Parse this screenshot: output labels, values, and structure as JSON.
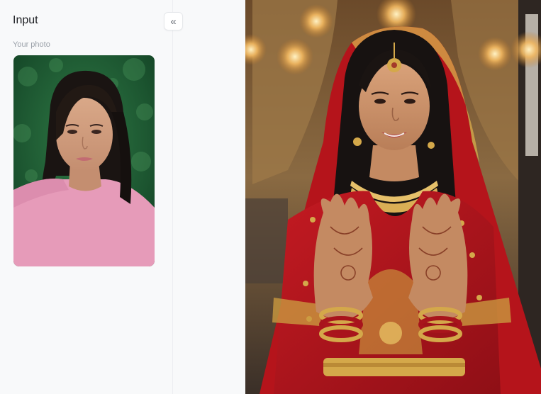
{
  "panel": {
    "title": "Input",
    "photo_label": "Your photo",
    "collapse_glyph": "«"
  },
  "icons": {
    "collapse": "double-chevron-left-icon"
  },
  "colors": {
    "panel_bg": "#f8f9fa",
    "dress_red": "#b5141b",
    "gold": "#d4a84a",
    "shirt_pink": "#e89ab8",
    "foliage_green": "#1f5a32"
  }
}
